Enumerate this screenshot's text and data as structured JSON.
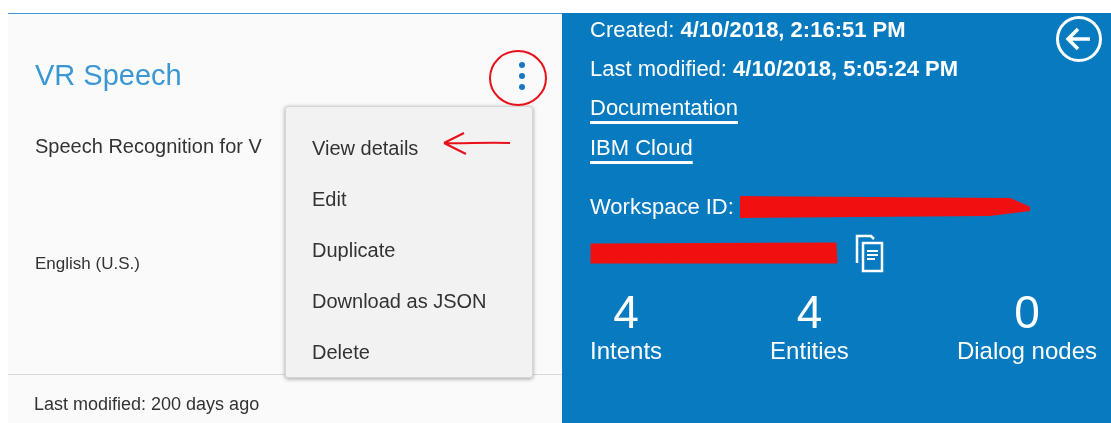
{
  "card": {
    "title": "VR Speech",
    "description": "Speech Recognition for V",
    "language": "English (U.S.)",
    "footer": "Last modified: 200 days ago"
  },
  "menu": {
    "items": [
      {
        "label": "View details"
      },
      {
        "label": "Edit"
      },
      {
        "label": "Duplicate"
      },
      {
        "label": "Download as JSON"
      },
      {
        "label": "Delete"
      }
    ]
  },
  "details": {
    "created": "Created: **4/10/2018, 2:16:51 PM**",
    "modified": "Last modified: **4/10/2018, 5:05:24 PM**",
    "links": [
      "Documentation",
      "IBM Cloud"
    ],
    "workspace_label": "Workspace ID:",
    "stats": [
      {
        "value": "4",
        "label": "Intents"
      },
      {
        "value": "4",
        "label": "Entities"
      },
      {
        "value": "0",
        "label": "Dialog nodes"
      }
    ]
  }
}
